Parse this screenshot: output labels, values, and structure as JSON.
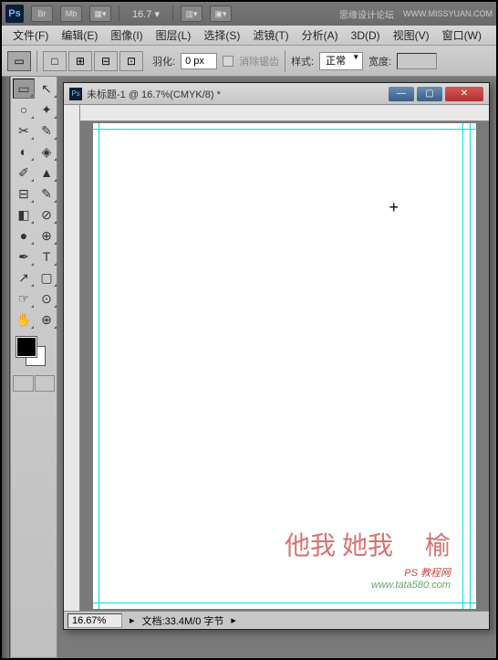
{
  "titlebar": {
    "logo": "Ps",
    "icons": [
      "Br",
      "Mb"
    ],
    "zoom": "16.7",
    "site_name": "思缘设计论坛",
    "site_url": "WWW.MISSYUAN.COM"
  },
  "menu": [
    "文件(F)",
    "编辑(E)",
    "图像(I)",
    "图层(L)",
    "选择(S)",
    "滤镜(T)",
    "分析(A)",
    "3D(D)",
    "视图(V)",
    "窗口(W)"
  ],
  "options": {
    "feather_label": "羽化:",
    "feather_value": "0 px",
    "antialias_label": "消除锯齿",
    "style_label": "样式:",
    "style_value": "正常",
    "width_label": "宽度:"
  },
  "tools": [
    {
      "glyph": "▭",
      "active": true
    },
    {
      "glyph": "↖"
    },
    {
      "glyph": "○"
    },
    {
      "glyph": "✦"
    },
    {
      "glyph": "✂"
    },
    {
      "glyph": "✎"
    },
    {
      "glyph": "◐"
    },
    {
      "glyph": "◈"
    },
    {
      "glyph": "✐"
    },
    {
      "glyph": "▲"
    },
    {
      "glyph": "⊟"
    },
    {
      "glyph": "✎"
    },
    {
      "glyph": "◧"
    },
    {
      "glyph": "⊘"
    },
    {
      "glyph": "●"
    },
    {
      "glyph": "⊕"
    },
    {
      "glyph": "✒"
    },
    {
      "glyph": "T"
    },
    {
      "glyph": "↗"
    },
    {
      "glyph": "▢"
    },
    {
      "glyph": "☞"
    },
    {
      "glyph": "⊙"
    },
    {
      "glyph": "✋"
    },
    {
      "glyph": "⊕"
    }
  ],
  "document": {
    "title": "未标题-1 @ 16.7%(CMYK/8) *",
    "status_zoom": "16.67%",
    "status_info": "文档:33.4M/0 字节"
  },
  "watermark": {
    "chinese": "他我\n她我\n　榆",
    "url1": "PS 教程网",
    "url2": "www.tata580.com"
  }
}
